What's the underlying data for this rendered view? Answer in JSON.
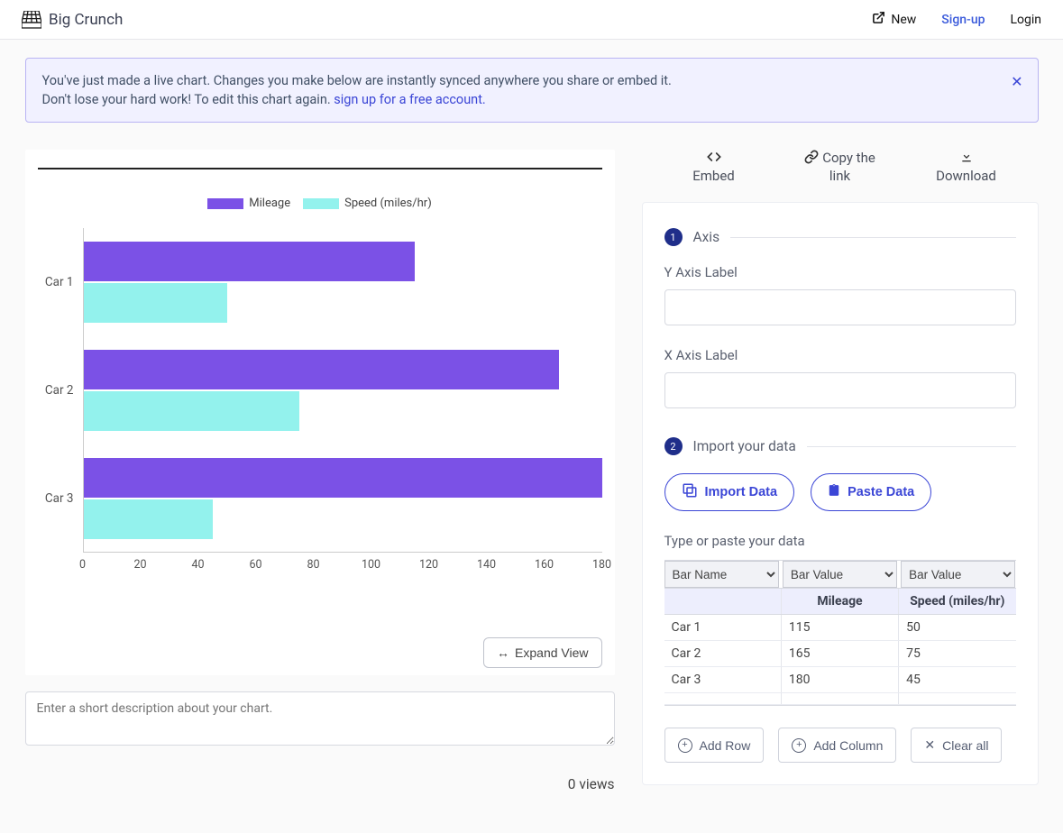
{
  "brand": "Big Crunch",
  "nav": {
    "new": "New",
    "signup": "Sign-up",
    "login": "Login"
  },
  "banner": {
    "line1": "You've just made a live chart. Changes you make below are instantly synced anywhere you share or embed it.",
    "line2_prefix": "Don't lose your hard work! To edit this chart again. ",
    "signup_link": "sign up for a free account."
  },
  "actions": {
    "embed": {
      "top": "",
      "bottom": "Embed"
    },
    "copy": {
      "top": "Copy the",
      "bottom": "link"
    },
    "download": {
      "top": "",
      "bottom": "Download"
    }
  },
  "chart_data": {
    "type": "bar",
    "orientation": "horizontal",
    "categories": [
      "Car 1",
      "Car 2",
      "Car 3"
    ],
    "series": [
      {
        "name": "Mileage",
        "values": [
          115,
          165,
          180
        ],
        "color": "#7b51e6"
      },
      {
        "name": "Speed (miles/hr)",
        "values": [
          50,
          75,
          45
        ],
        "color": "#93f2ed"
      }
    ],
    "xlim": [
      0,
      180
    ],
    "xticks": [
      0,
      20,
      40,
      60,
      80,
      100,
      120,
      140,
      160,
      180
    ],
    "title": "",
    "xlabel": "",
    "ylabel": ""
  },
  "expand": "Expand View",
  "desc_placeholder": "Enter a short description about your chart.",
  "views": "0 views",
  "panel": {
    "sec1": "Axis",
    "ylabel": "Y Axis Label",
    "xlabel": "X Axis Label",
    "sec2": "Import your data",
    "import_btn": "Import Data",
    "paste_btn": "Paste Data",
    "hint": "Type or paste your data",
    "col_selectors": [
      "Bar Name",
      "Bar Value",
      "Bar Value"
    ],
    "sub_headers": [
      "",
      "Mileage",
      "Speed (miles/hr)"
    ],
    "rows": [
      [
        "Car 1",
        "115",
        "50"
      ],
      [
        "Car 2",
        "165",
        "75"
      ],
      [
        "Car 3",
        "180",
        "45"
      ],
      [
        "",
        "",
        ""
      ]
    ],
    "add_row": "Add Row",
    "add_col": "Add Column",
    "clear": "Clear all"
  }
}
